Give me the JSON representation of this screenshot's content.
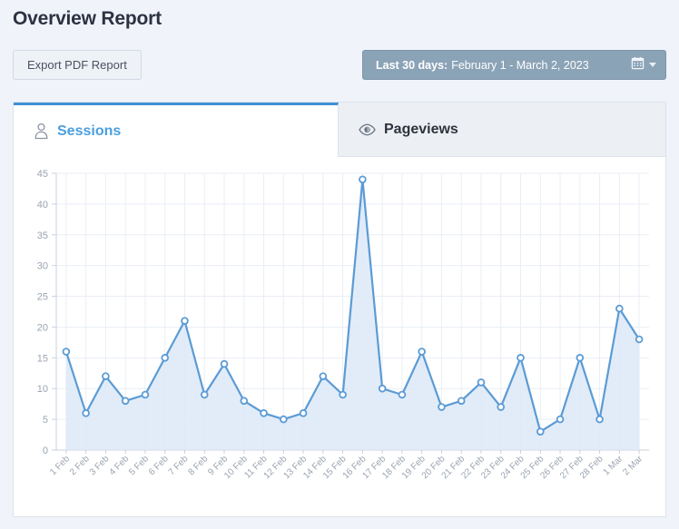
{
  "header": {
    "title": "Overview Report",
    "export_label": "Export PDF Report",
    "daterange": {
      "label": "Last 30 days:",
      "value": "February 1 - March 2, 2023",
      "calendar_icon": "calendar-icon",
      "caret_icon": "chevron-down-icon"
    }
  },
  "tabs": [
    {
      "label": "Sessions",
      "icon": "user-icon",
      "active": true
    },
    {
      "label": "Pageviews",
      "icon": "eye-icon",
      "active": false
    }
  ],
  "colors": {
    "page_background": "#f0f3fa",
    "accent": "#3f8fd4",
    "line": "#5b9bd5",
    "area_fill": "#dce9f7",
    "active_tab_text": "#4a9fe0",
    "daterange_bg": "#8ba3b7",
    "grid": "#e9eef6",
    "axis_text": "#9aa3b0"
  },
  "chart_data": {
    "type": "area",
    "title": "",
    "xlabel": "",
    "ylabel": "",
    "ylim": [
      0,
      45
    ],
    "yticks": [
      0,
      5,
      10,
      15,
      20,
      25,
      30,
      35,
      40,
      45
    ],
    "grid": true,
    "legend": false,
    "series_name": "Sessions",
    "categories": [
      "1 Feb",
      "2 Feb",
      "3 Feb",
      "4 Feb",
      "5 Feb",
      "6 Feb",
      "7 Feb",
      "8 Feb",
      "9 Feb",
      "10 Feb",
      "11 Feb",
      "12 Feb",
      "13 Feb",
      "14 Feb",
      "15 Feb",
      "16 Feb",
      "17 Feb",
      "18 Feb",
      "19 Feb",
      "20 Feb",
      "21 Feb",
      "22 Feb",
      "23 Feb",
      "24 Feb",
      "25 Feb",
      "26 Feb",
      "27 Feb",
      "28 Feb",
      "1 Mar",
      "2 Mar"
    ],
    "values": [
      16,
      6,
      12,
      8,
      9,
      15,
      21,
      9,
      14,
      8,
      6,
      5,
      6,
      12,
      9,
      44,
      10,
      9,
      16,
      7,
      8,
      11,
      7,
      15,
      3,
      5,
      15,
      5,
      23,
      18
    ]
  }
}
